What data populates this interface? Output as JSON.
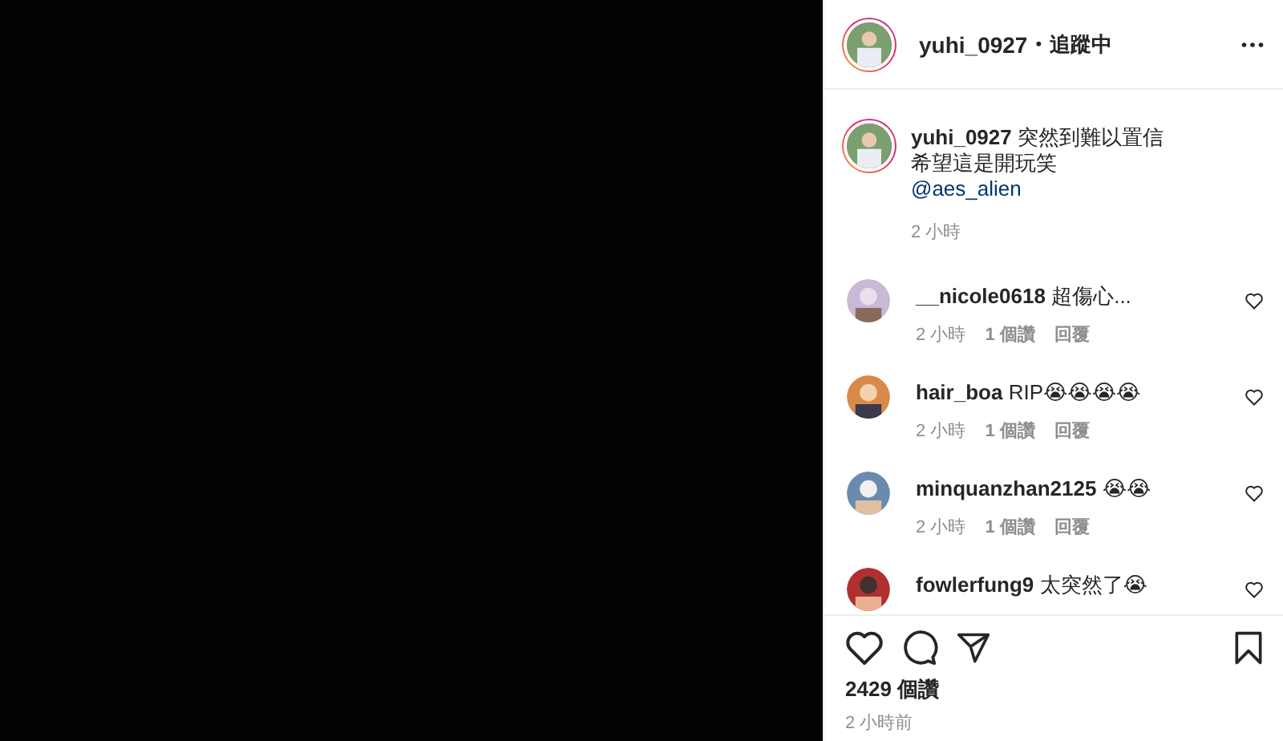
{
  "header": {
    "username": "yuhi_0927",
    "separator": "•",
    "follow_status": "追蹤中"
  },
  "caption": {
    "username": "yuhi_0927",
    "lines": [
      "突然到難以置信",
      "希望這是開玩笑"
    ],
    "mention": "@aes_alien",
    "time": "2 小時"
  },
  "comments": [
    {
      "username": "__nicole0618",
      "text": "超傷心...",
      "time": "2 小時",
      "likes": "1 個讚",
      "reply": "回覆"
    },
    {
      "username": "hair_boa",
      "text": "RIP😭😭😭😭",
      "time": "2 小時",
      "likes": "1 個讚",
      "reply": "回覆"
    },
    {
      "username": "minquanzhan2125",
      "text": "😭😭",
      "time": "2 小時",
      "likes": "1 個讚",
      "reply": "回覆"
    },
    {
      "username": "fowlerfung9",
      "text": "太突然了😭"
    }
  ],
  "footer": {
    "likes": "2429 個讚",
    "time": "2 小時前"
  }
}
